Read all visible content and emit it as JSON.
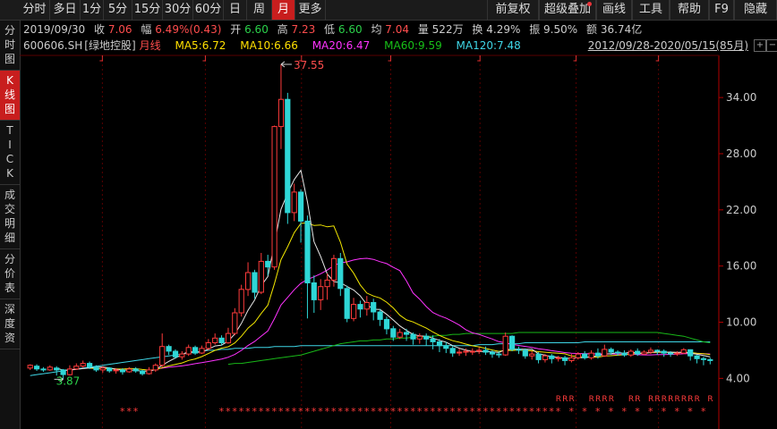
{
  "toolbar": {
    "periods": [
      "分时",
      "多日",
      "1分",
      "5分",
      "15分",
      "30分",
      "60分",
      "日",
      "周",
      "月",
      "更多"
    ],
    "active_period": "月",
    "right": [
      "前复权",
      "超级叠加",
      "画线",
      "工具",
      "帮助",
      "F9",
      "隐藏"
    ]
  },
  "sidebar": [
    {
      "label": "分时图",
      "active": false
    },
    {
      "label": "K线图",
      "active": true
    },
    {
      "label": "TICK",
      "active": false
    },
    {
      "label": "成交明细",
      "active": false
    },
    {
      "label": "分价表",
      "active": false
    },
    {
      "label": "深度资",
      "active": false
    }
  ],
  "info": {
    "date": "2019/09/30",
    "close_label": "收",
    "close": "7.06",
    "change_label": "幅",
    "change": "6.49%(0.43)",
    "open_label": "开",
    "open": "6.60",
    "high_label": "高",
    "high": "7.23",
    "low_label": "低",
    "low": "6.60",
    "avg_label": "均",
    "avg": "7.04",
    "vol_label": "量",
    "vol": "522万",
    "turnover_label": "换",
    "turnover": "4.29%",
    "amp_label": "振",
    "amp": "9.50%",
    "amount_label": "额",
    "amount": "36.74亿"
  },
  "ma_bar": {
    "code": "600606.SH",
    "name": "[绿地控股]",
    "line": "月线",
    "ma5": "MA5:6.72",
    "ma10": "MA10:6.66",
    "ma20": "MA20:6.47",
    "ma60": "MA60:9.59",
    "ma120": "MA120:7.48",
    "range": "2012/09/28-2020/05/15(85月)"
  },
  "controls": {
    "plus": "+",
    "minus": "−"
  },
  "colors": {
    "up": "#ff3b3b",
    "down": "#2fd6d6",
    "ma5": "#e6e6e6",
    "ma10": "#f2e600",
    "ma20": "#ff33ff",
    "ma60": "#18b818",
    "ma120": "#3fd6e6",
    "accent": "#c81e1e"
  },
  "chart_data": {
    "type": "candlestick",
    "y_ticks": [
      "34.00",
      "28.00",
      "22.00",
      "16.00",
      "10.00",
      "4.00"
    ],
    "y_tick_values": [
      34,
      28,
      22,
      16,
      10,
      4
    ],
    "ylim": [
      2.6,
      38.5
    ],
    "high_annotation": "37.55",
    "low_annotation": "3.87",
    "candles": [
      [
        5.1,
        5.4,
        4.9,
        5.5
      ],
      [
        5.3,
        5.0,
        4.8,
        5.5
      ],
      [
        5.0,
        4.9,
        4.7,
        5.2
      ],
      [
        4.9,
        5.2,
        4.8,
        5.4
      ],
      [
        5.1,
        4.9,
        4.3,
        5.3
      ],
      [
        4.9,
        4.4,
        3.9,
        5.0
      ],
      [
        4.4,
        5.0,
        4.3,
        5.4
      ],
      [
        5.0,
        5.3,
        4.9,
        5.6
      ],
      [
        5.3,
        5.6,
        5.1,
        5.9
      ],
      [
        5.6,
        5.2,
        5.0,
        5.8
      ],
      [
        5.2,
        4.9,
        4.7,
        5.4
      ],
      [
        4.9,
        5.1,
        4.6,
        5.3
      ],
      [
        5.1,
        4.8,
        4.6,
        5.2
      ],
      [
        4.8,
        4.9,
        4.5,
        5.1
      ],
      [
        4.9,
        4.7,
        4.4,
        5.1
      ],
      [
        4.7,
        5.0,
        4.6,
        5.2
      ],
      [
        5.0,
        4.8,
        4.6,
        5.2
      ],
      [
        4.8,
        4.5,
        4.3,
        4.9
      ],
      [
        4.5,
        4.9,
        4.4,
        5.2
      ],
      [
        4.9,
        5.4,
        4.7,
        5.6
      ],
      [
        5.4,
        7.4,
        5.2,
        8.8
      ],
      [
        7.4,
        6.9,
        6.5,
        7.6
      ],
      [
        6.9,
        6.3,
        6.1,
        7.1
      ],
      [
        6.3,
        6.6,
        6.0,
        6.9
      ],
      [
        6.6,
        7.3,
        6.4,
        7.6
      ],
      [
        7.3,
        6.7,
        6.5,
        7.5
      ],
      [
        6.7,
        7.2,
        6.6,
        7.5
      ],
      [
        7.2,
        7.8,
        7.0,
        8.2
      ],
      [
        7.8,
        8.3,
        7.6,
        8.8
      ],
      [
        8.3,
        7.8,
        7.5,
        8.6
      ],
      [
        7.8,
        8.8,
        7.7,
        9.4
      ],
      [
        8.8,
        11.0,
        8.6,
        11.5
      ],
      [
        11.0,
        13.5,
        10.6,
        14.0
      ],
      [
        13.5,
        15.3,
        12.8,
        16.4
      ],
      [
        15.3,
        13.2,
        12.5,
        15.6
      ],
      [
        13.2,
        16.5,
        13.0,
        17.4
      ],
      [
        16.5,
        15.9,
        15.0,
        17.2
      ],
      [
        15.9,
        30.9,
        15.6,
        31.0
      ],
      [
        30.9,
        33.8,
        28.5,
        37.55
      ],
      [
        33.8,
        21.7,
        20.5,
        34.5
      ],
      [
        21.7,
        23.9,
        20.8,
        24.8
      ],
      [
        23.9,
        20.8,
        18.5,
        24.2
      ],
      [
        20.8,
        14.2,
        10.4,
        21.4
      ],
      [
        14.2,
        12.4,
        11.0,
        15.0
      ],
      [
        12.4,
        13.8,
        11.3,
        14.6
      ],
      [
        13.8,
        14.5,
        12.4,
        15.2
      ],
      [
        14.5,
        16.8,
        13.8,
        17.2
      ],
      [
        16.8,
        13.6,
        12.8,
        17.4
      ],
      [
        13.6,
        10.4,
        10.0,
        13.9
      ],
      [
        10.4,
        11.9,
        10.1,
        12.6
      ],
      [
        11.9,
        11.4,
        10.5,
        12.3
      ],
      [
        11.4,
        12.1,
        10.7,
        12.8
      ],
      [
        12.1,
        11.1,
        10.2,
        12.5
      ],
      [
        11.1,
        10.3,
        9.6,
        11.4
      ],
      [
        10.3,
        9.3,
        8.7,
        10.6
      ],
      [
        9.3,
        8.4,
        8.0,
        9.6
      ],
      [
        8.4,
        8.9,
        8.2,
        9.3
      ],
      [
        8.9,
        8.7,
        8.0,
        9.3
      ],
      [
        8.7,
        8.2,
        7.6,
        8.9
      ],
      [
        8.2,
        8.5,
        7.7,
        8.8
      ],
      [
        8.5,
        8.2,
        7.5,
        8.8
      ],
      [
        8.2,
        7.9,
        7.1,
        8.6
      ],
      [
        7.9,
        7.5,
        6.8,
        8.2
      ],
      [
        7.5,
        7.2,
        6.7,
        7.9
      ],
      [
        7.2,
        6.7,
        6.3,
        7.5
      ],
      [
        6.7,
        6.8,
        6.4,
        7.2
      ],
      [
        6.8,
        6.9,
        6.4,
        7.2
      ],
      [
        6.9,
        6.9,
        6.5,
        7.2
      ],
      [
        6.9,
        7.0,
        6.6,
        7.3
      ],
      [
        7.0,
        6.8,
        6.5,
        7.4
      ],
      [
        6.8,
        6.6,
        6.2,
        7.0
      ],
      [
        6.6,
        6.5,
        6.2,
        6.9
      ],
      [
        6.5,
        8.5,
        6.4,
        8.9
      ],
      [
        8.5,
        7.1,
        6.9,
        8.6
      ],
      [
        7.1,
        7.0,
        6.6,
        7.4
      ],
      [
        7.0,
        6.4,
        6.1,
        7.2
      ],
      [
        6.4,
        6.6,
        6.0,
        6.9
      ],
      [
        6.6,
        6.0,
        5.6,
        6.8
      ],
      [
        6.0,
        6.4,
        5.7,
        6.6
      ],
      [
        6.4,
        6.1,
        5.6,
        6.6
      ],
      [
        6.1,
        6.2,
        5.8,
        6.4
      ],
      [
        6.2,
        5.9,
        5.4,
        6.4
      ],
      [
        5.9,
        6.2,
        5.7,
        6.6
      ],
      [
        6.2,
        6.6,
        6.0,
        6.8
      ],
      [
        6.6,
        6.2,
        6.0,
        6.9
      ],
      [
        6.2,
        6.7,
        6.0,
        7.0
      ],
      [
        6.7,
        6.4,
        6.1,
        7.2
      ],
      [
        6.4,
        7.1,
        6.3,
        7.6
      ],
      [
        7.1,
        6.8,
        6.5,
        7.3
      ],
      [
        6.8,
        6.7,
        6.4,
        7.0
      ],
      [
        6.7,
        6.5,
        6.3,
        7.0
      ],
      [
        6.5,
        6.9,
        6.3,
        7.1
      ],
      [
        6.9,
        6.6,
        6.4,
        7.2
      ],
      [
        6.6,
        6.8,
        6.5,
        7.0
      ],
      [
        6.8,
        7.0,
        6.6,
        7.3
      ],
      [
        7.0,
        6.9,
        6.5,
        7.1
      ],
      [
        6.9,
        6.7,
        6.3,
        7.1
      ],
      [
        6.7,
        6.6,
        6.3,
        6.9
      ],
      [
        6.6,
        6.7,
        6.4,
        6.9
      ],
      [
        6.7,
        7.06,
        6.6,
        7.23
      ],
      [
        7.06,
        6.4,
        5.9,
        7.1
      ],
      [
        6.4,
        6.1,
        5.6,
        6.5
      ],
      [
        6.1,
        6.0,
        5.4,
        6.3
      ],
      [
        6.0,
        5.9,
        5.5,
        6.2
      ]
    ],
    "ma60": [
      5.5,
      5.6,
      5.6,
      5.7,
      5.8,
      5.9,
      6.0,
      6.1,
      6.2,
      6.3,
      6.4,
      6.5,
      6.7,
      6.9,
      7.1,
      7.3,
      7.5,
      7.7,
      7.8,
      7.9,
      8.0,
      8.0,
      8.1,
      8.1,
      8.2,
      8.2,
      8.3,
      8.3,
      8.4,
      8.4,
      8.5,
      8.5,
      8.6,
      8.6,
      8.7,
      8.7,
      8.8,
      8.8,
      8.8,
      8.8,
      8.8,
      8.8,
      8.8,
      8.8,
      8.9,
      8.9,
      8.9,
      8.9,
      8.9,
      8.9,
      8.9,
      8.9,
      8.9,
      8.9,
      8.9,
      8.9,
      8.9,
      8.9,
      8.9,
      8.9,
      8.9,
      8.9,
      8.9,
      8.9,
      8.9,
      8.9,
      8.8,
      8.7,
      8.6,
      8.5,
      8.3,
      8.1,
      7.9,
      7.8
    ],
    "ma120": [
      4.3,
      4.4,
      4.5,
      4.6,
      4.7,
      4.8,
      4.9,
      5.0,
      5.1,
      5.2,
      5.3,
      5.4,
      5.5,
      5.6,
      5.7,
      5.8,
      5.9,
      6.0,
      6.1,
      6.2,
      6.3,
      6.4,
      6.5,
      6.6,
      6.7,
      6.8,
      6.9,
      7.0,
      7.0,
      7.1,
      7.1,
      7.2,
      7.2,
      7.2,
      7.3,
      7.3,
      7.3,
      7.4,
      7.4,
      7.4,
      7.4,
      7.5,
      7.5,
      7.5,
      7.5,
      7.5,
      7.5,
      7.5,
      7.5,
      7.5,
      7.5,
      7.5,
      7.5,
      7.5,
      7.5,
      7.5,
      7.5,
      7.5,
      7.5,
      7.5,
      7.5,
      7.5,
      7.5,
      7.5,
      7.5,
      7.5,
      7.5,
      7.5,
      7.6,
      7.6,
      7.6,
      7.7,
      7.7,
      7.7,
      7.7,
      7.8,
      7.8,
      7.8,
      7.8,
      7.8,
      7.8,
      7.8,
      7.8,
      7.8,
      7.9,
      7.9,
      7.9,
      7.9,
      7.9,
      7.9,
      7.9,
      7.9,
      7.9,
      7.9,
      7.9,
      7.9,
      7.9,
      7.9,
      7.9,
      7.9,
      7.9,
      7.9,
      7.9,
      7.9
    ],
    "r_marker": "R",
    "star_marker": "*"
  }
}
